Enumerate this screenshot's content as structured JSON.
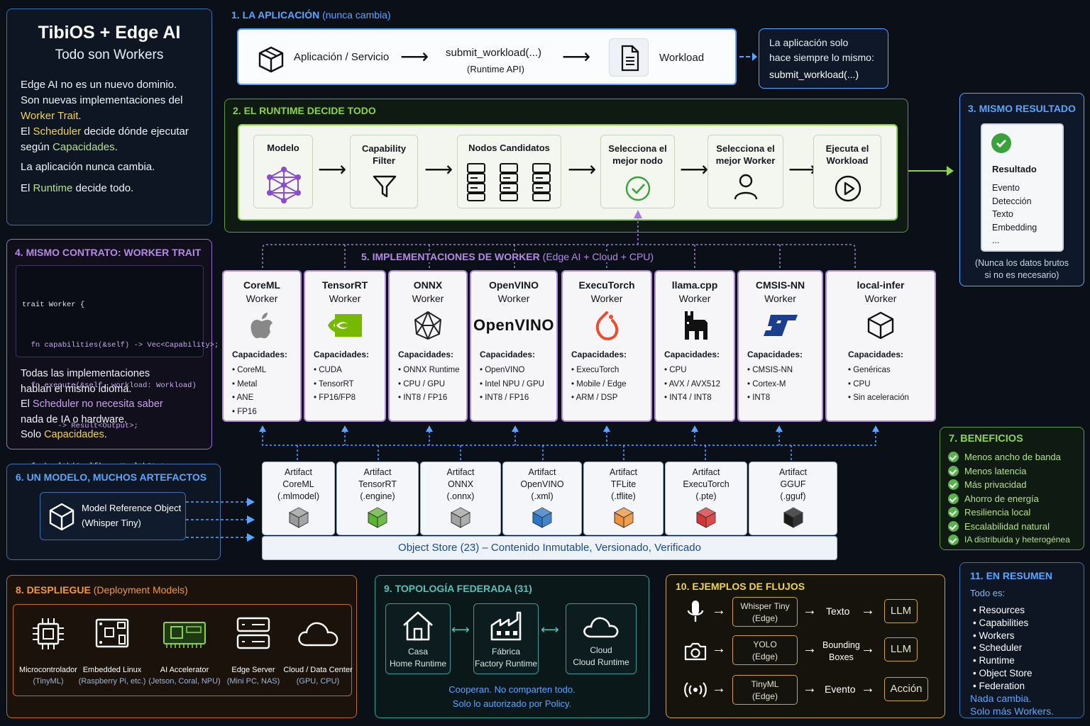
{
  "intro": {
    "title": "TibiOS + Edge AI",
    "subtitle": "Todo son Workers",
    "line1": "Edge AI no es un nuevo dominio.",
    "line2": "Son nuevas implementaciones del",
    "line3_hl": "Worker Trait",
    "line3_end": ".",
    "line4_pre": "El ",
    "line4_hl": "Scheduler",
    "line4_end": " decide dónde ejecutar",
    "line5_pre": "según ",
    "line5_hl": "Capacidades",
    "line5_end": ".",
    "line6": "La aplicación nunca cambia.",
    "line7_pre": "El ",
    "line7_hl": "Runtime",
    "line7_end": " decide todo."
  },
  "app": {
    "title_num": "1. LA APLICACIÓN",
    "title_note": "(nunca cambia)",
    "service": "Aplicación / Servicio",
    "api": "submit_workload(...)",
    "api_sub": "(Runtime API)",
    "workload": "Workload",
    "note1": "La aplicación solo",
    "note2": "hace siempre lo mismo:",
    "note3": "submit_workload(...)"
  },
  "runtime": {
    "title": "2. EL RUNTIME DECIDE TODO",
    "steps": [
      "Modelo",
      "Capability Filter",
      "Nodos Candidatos",
      "Selecciona el mejor nodo",
      "Selecciona el mejor Worker",
      "Ejecuta el Workload"
    ]
  },
  "result": {
    "title": "3. MISMO RESULTADO",
    "heading": "Resultado",
    "items": [
      "Evento",
      "Detección",
      "Texto",
      "Embedding",
      "..."
    ],
    "note1": "(Nunca los datos brutos",
    "note2": "si no es necesario)"
  },
  "contract": {
    "title": "4. MISMO CONTRATO: WORKER TRAIT",
    "code": [
      "trait Worker {",
      "  fn capabilities(&self) -> Vec<Capability>;",
      "  fn execute(&self, workload: Workload)",
      "        -> Result<Output>;",
      "  fn health(&self) -> HealthStatus;",
      "}"
    ],
    "p1": "Todas las implementaciones",
    "p2": "hablan el mismo idioma.",
    "p3_pre": "El ",
    "p3_hl": "Scheduler no necesita saber",
    "p4": "nada de IA o hardware.",
    "p5_pre": "Solo ",
    "p5_hl": "Capacidades",
    "p5_end": "."
  },
  "workers": {
    "title_num": "5. IMPLEMENTACIONES DE WORKER",
    "title_note": "(Edge AI + Cloud + CPU)",
    "cap_label": "Capacidades:",
    "worker_word": "Worker",
    "items": [
      {
        "name": "CoreML",
        "caps": [
          "CoreML",
          "Metal",
          "ANE",
          "FP16"
        ]
      },
      {
        "name": "TensorRT",
        "caps": [
          "CUDA",
          "TensorRT",
          "FP16/FP8"
        ]
      },
      {
        "name": "ONNX",
        "caps": [
          "ONNX Runtime",
          "CPU / GPU",
          "INT8 / FP16"
        ]
      },
      {
        "name": "OpenVINO",
        "caps": [
          "OpenVINO",
          "Intel NPU / GPU",
          "INT8 / FP16"
        ]
      },
      {
        "name": "ExecuTorch",
        "caps": [
          "ExecuTorch",
          "Mobile / Edge",
          "ARM / DSP"
        ]
      },
      {
        "name": "llama.cpp",
        "caps": [
          "CPU",
          "AVX / AVX512",
          "INT4 / INT8"
        ]
      },
      {
        "name": "CMSIS-NN",
        "caps": [
          "CMSIS-NN",
          "Cortex-M",
          "INT8"
        ]
      },
      {
        "name": "local-infer",
        "caps": [
          "Genéricas",
          "CPU",
          "Sin aceleración"
        ]
      }
    ],
    "openvino_logo": "OpenVINO"
  },
  "model": {
    "title": "6. UN MODELO, MUCHOS ARTEFACTOS",
    "ref1": "Model Reference Object",
    "ref2": "(Whisper Tiny)"
  },
  "artifacts": {
    "word": "Artifact",
    "items": [
      {
        "name": "CoreML",
        "ext": "(.mlmodel)",
        "color": "#9a9a9a"
      },
      {
        "name": "TensorRT",
        "ext": "(.engine)",
        "color": "#5bb531"
      },
      {
        "name": "ONNX",
        "ext": "(.onnx)",
        "color": "#a3a3a3"
      },
      {
        "name": "OpenVINO",
        "ext": "(.xml)",
        "color": "#2a76c8"
      },
      {
        "name": "TFLite",
        "ext": "(.tflite)",
        "color": "#f0923a"
      },
      {
        "name": "ExecuTorch",
        "ext": "(.pte)",
        "color": "#d83434"
      },
      {
        "name": "GGUF",
        "ext": "(.gguf)",
        "color": "#1a1a1a"
      }
    ],
    "store": "Object Store (23) – Contenido Inmutable, Versionado, Verificado"
  },
  "benefits": {
    "title": "7. BENEFICIOS",
    "items": [
      "Menos ancho de banda",
      "Menos latencia",
      "Más privacidad",
      "Ahorro de energía",
      "Resiliencia local",
      "Escalabilidad natural",
      "IA distribuida y heterogénea"
    ]
  },
  "deploy": {
    "title_num": "8. DESPLIEGUE",
    "title_note": "(Deployment Models)",
    "items": [
      {
        "name": "Microcontrolador",
        "sub": "(TinyML)"
      },
      {
        "name": "Embedded Linux",
        "sub": "(Raspberry Pi, etc.)"
      },
      {
        "name": "AI Accelerator",
        "sub": "(Jetson, Coral, NPU)"
      },
      {
        "name": "Edge Server",
        "sub": "(Mini PC, NAS)"
      },
      {
        "name": "Cloud / Data Center",
        "sub": "(GPU, CPU)"
      }
    ]
  },
  "topology": {
    "title": "9. TOPOLOGÍA FEDERADA (31)",
    "nodes": [
      {
        "name": "Casa",
        "sub": "Home Runtime"
      },
      {
        "name": "Fábrica",
        "sub": "Factory Runtime"
      },
      {
        "name": "Cloud",
        "sub": "Cloud Runtime"
      }
    ],
    "note1": "Cooperan. No comparten todo.",
    "note2": "Solo lo autorizado por Policy."
  },
  "flows": {
    "title": "10. EJEMPLOS DE FLUJOS",
    "rows": [
      {
        "model": "Whisper Tiny",
        "loc": "(Edge)",
        "out": "Texto",
        "out2": "",
        "final": "LLM"
      },
      {
        "model": "YOLO",
        "loc": "(Edge)",
        "out": "Bounding",
        "out2": "Boxes",
        "final": "LLM"
      },
      {
        "model": "TinyML",
        "loc": "(Edge)",
        "out": "Evento",
        "out2": "",
        "final": "Acción"
      }
    ]
  },
  "summary": {
    "title": "11. EN RESUMEN",
    "lead": "Todo es:",
    "items": [
      "Resources",
      "Capabilities",
      "Workers",
      "Scheduler",
      "Runtime",
      "Object Store",
      "Federation"
    ],
    "end1": "Nada cambia.",
    "end2": "Solo más Workers."
  },
  "colors": {
    "accent_blue": "#5aa6ff",
    "accent_green": "#8fd14f",
    "accent_purple": "#b48be0",
    "accent_yellow": "#f2d34a",
    "accent_orange": "#f09a3e",
    "accent_teal": "#57c1b8"
  }
}
